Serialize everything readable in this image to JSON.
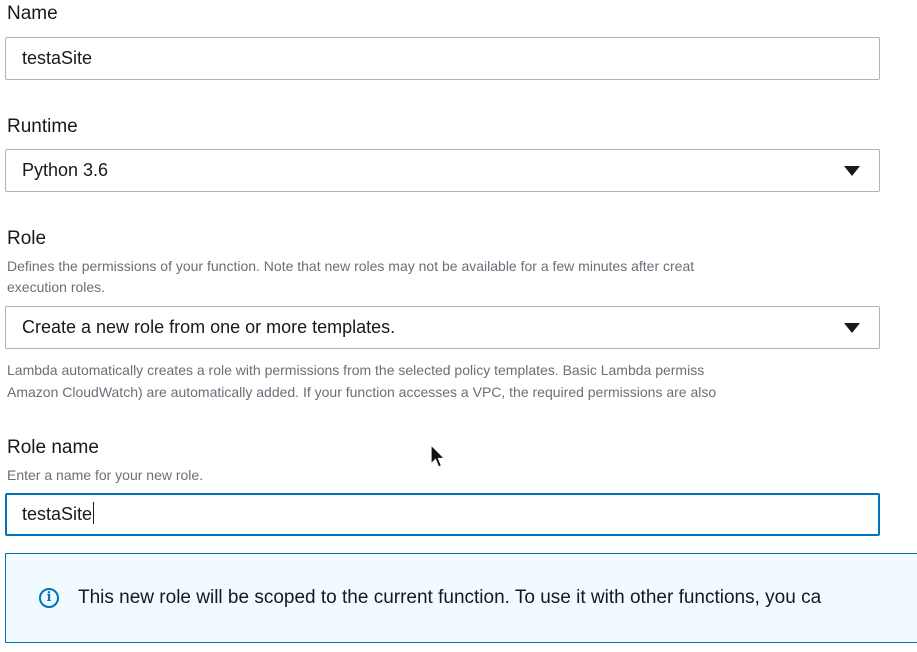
{
  "name": {
    "label": "Name",
    "value": "testaSite"
  },
  "runtime": {
    "label": "Runtime",
    "selected": "Python 3.6"
  },
  "role": {
    "label": "Role",
    "description_line1": "Defines the permissions of your function. Note that new roles may not be available for a few minutes after creat",
    "description_line2": "execution roles.",
    "selected": "Create a new role from one or more templates.",
    "help_line1": "Lambda automatically creates a role with permissions from the selected policy templates. Basic Lambda permiss",
    "help_line2": "Amazon CloudWatch) are automatically added. If your function accesses a VPC, the required permissions are also"
  },
  "role_name": {
    "label": "Role name",
    "description": "Enter a name for your new role.",
    "value": "testaSite"
  },
  "info": {
    "icon": "info-icon",
    "icon_glyph": "i",
    "text": "This new role will be scoped to the current function. To use it with other functions, you ca"
  },
  "colors": {
    "focus_border": "#0073bb",
    "info_background": "#f1faff",
    "input_border": "#aab7b8",
    "muted_text": "#687078"
  }
}
